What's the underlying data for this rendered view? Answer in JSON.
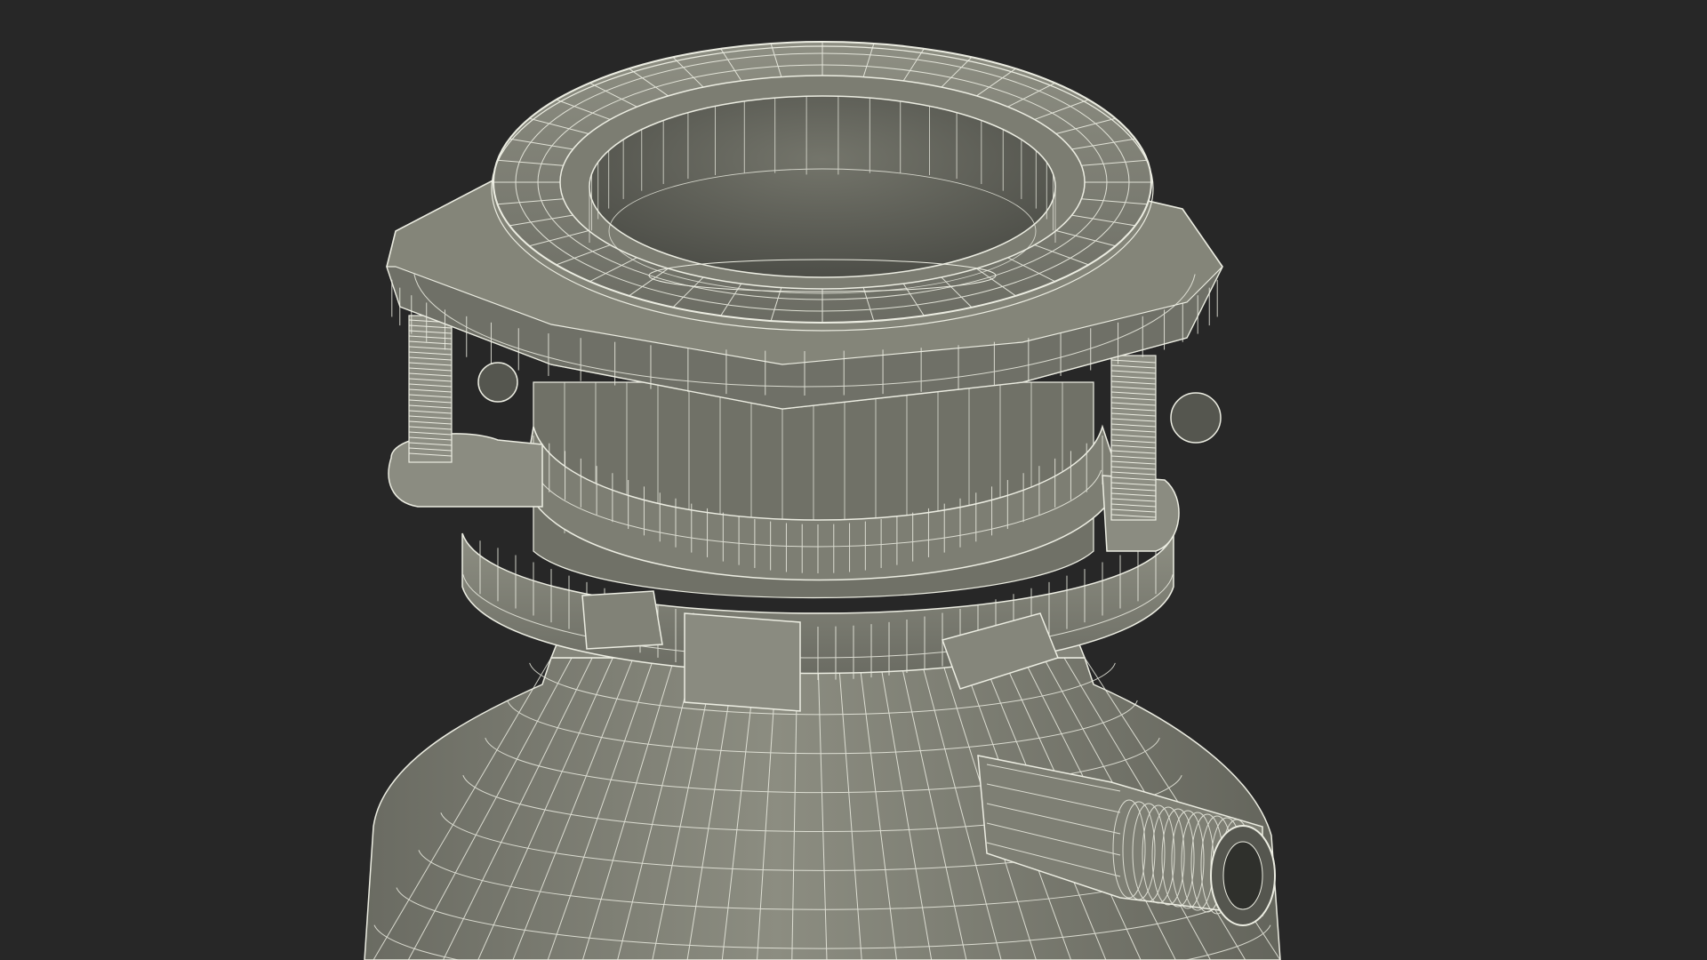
{
  "scene": {
    "subject": "garbage-disposal-mounting-assembly",
    "render_style": "wireframe-over-shaded",
    "colors": {
      "background": "#272727",
      "surface": "#85867a",
      "surface_light": "#9a9b8f",
      "surface_dark": "#5f6058",
      "interior": "#6d6e64",
      "interior_deep": "#3e3f39",
      "wire": "#ecede2"
    }
  }
}
